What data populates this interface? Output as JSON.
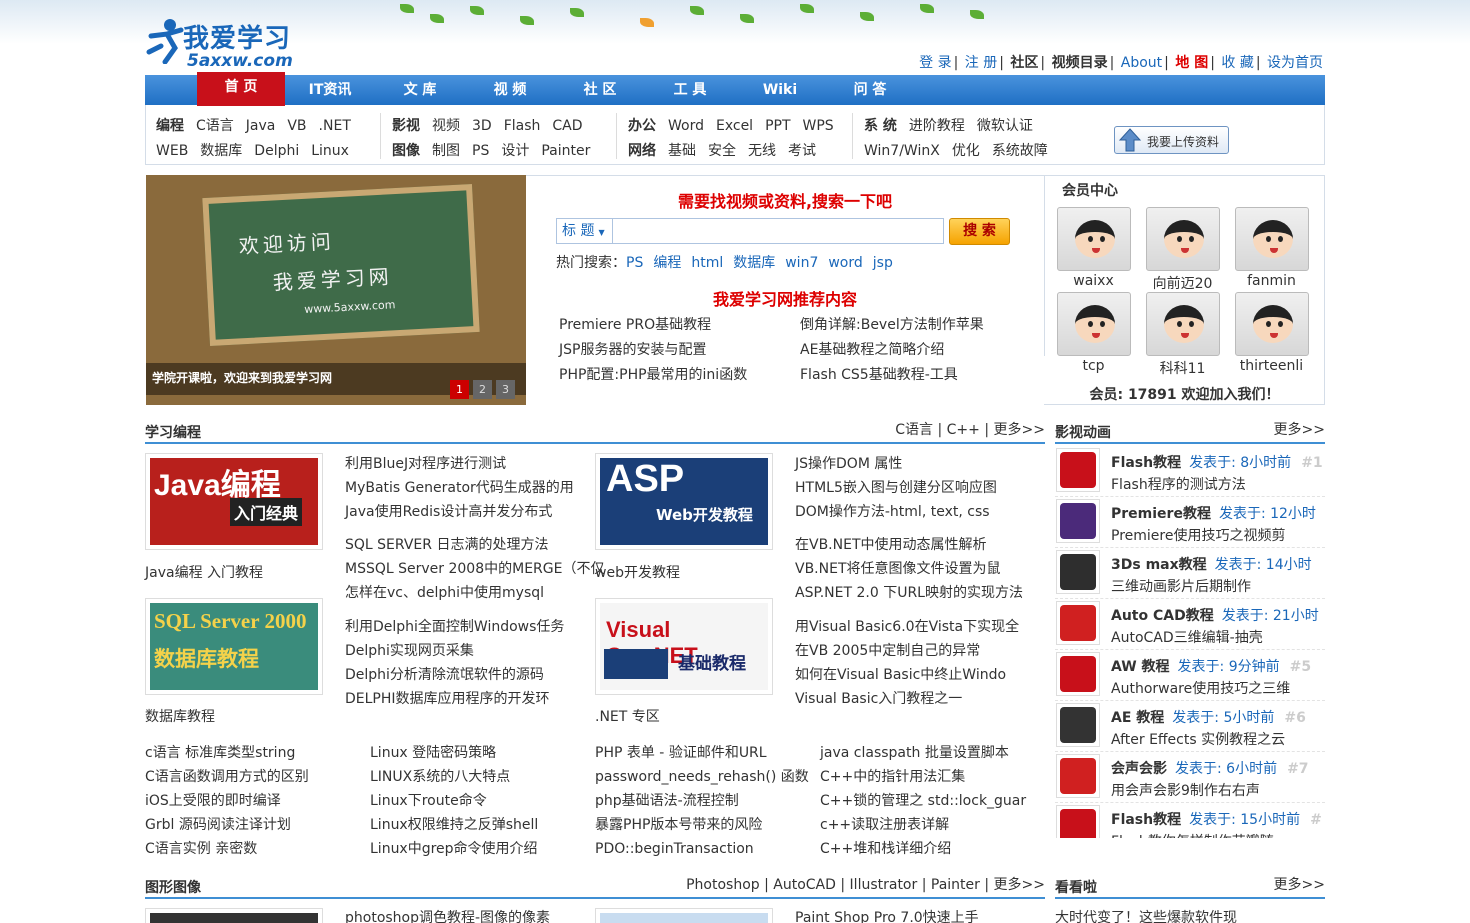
{
  "header": {
    "logo_cn": "我爱学习",
    "logo_en": "5axxw.com",
    "links": [
      "登 录",
      "注 册",
      "社区",
      "视频目录",
      "About",
      "地 图",
      "收 藏",
      "设为首页"
    ]
  },
  "nav": [
    "首 页",
    "IT资讯",
    "文 库",
    "视 频",
    "社 区",
    "工 具",
    "Wiki",
    "问 答"
  ],
  "subnav": {
    "g1": {
      "r1": {
        "head": "编程",
        "items": [
          "C语言",
          "Java",
          "VB",
          ".NET"
        ]
      },
      "r2": {
        "items": [
          "WEB",
          "数据库",
          "Delphi",
          "Linux"
        ]
      }
    },
    "g2": {
      "r1": {
        "head": "影视",
        "items": [
          "视频",
          "3D",
          "Flash",
          "CAD"
        ]
      },
      "r2": {
        "head": "图像",
        "items": [
          "制图",
          "PS",
          "设计",
          "Painter"
        ]
      }
    },
    "g3": {
      "r1": {
        "head": "办公",
        "items": [
          "Word",
          "Excel",
          "PPT",
          "WPS"
        ]
      },
      "r2": {
        "head": "网络",
        "items": [
          "基础",
          "安全",
          "无线",
          "考试"
        ]
      }
    },
    "g4": {
      "r1": {
        "head": "系 统",
        "items": [
          "进阶教程",
          "微软认证"
        ]
      },
      "r2": {
        "items": [
          "Win7/WinX",
          "优化",
          "系统故障"
        ]
      }
    },
    "upload": "我要上传资料"
  },
  "slide": {
    "board_line1": "欢迎访问",
    "board_line2": "我爱学习网",
    "board_line3": "www.5axxw.com",
    "caption": "学院开课啦，欢迎来到我爱学习网",
    "dots": [
      "1",
      "2",
      "3"
    ]
  },
  "search": {
    "title": "需要找视频或资料,搜索一下吧",
    "tag": "标 题",
    "button": "搜 索",
    "hot_label": "热门搜索：",
    "hot": [
      "PS",
      "编程",
      "html",
      "数据库",
      "win7",
      "word",
      "jsp"
    ]
  },
  "recommend": {
    "title": "我爱学习网推荐内容",
    "left": [
      "Premiere PRO基础教程",
      "JSP服务器的安装与配置",
      "PHP配置:PHP最常用的ini函数"
    ],
    "right": [
      "倒角详解:Bevel方法制作苹果",
      "AE基础教程之简略介绍",
      "Flash CS5基础教程-工具"
    ]
  },
  "member": {
    "title": "会员中心",
    "users": [
      "waixx",
      "向前迈20",
      "fanmin",
      "tcp",
      "科科11",
      "thirteenli"
    ],
    "total": "会员: 17891 欢迎加入我们！"
  },
  "programming": {
    "title": "学习编程",
    "more_links": [
      "C语言",
      "C++",
      "更多>>"
    ],
    "thumbs": [
      "Java编程 入门教程",
      "数据库教程",
      "ASP",
      "Web开发教程",
      ".NET 专区"
    ],
    "java_img": {
      "l1": "Java编程",
      "l2": "入门经典"
    },
    "sql_img": {
      "l1": "SQL Server 2000",
      "l2": "数据库教程"
    },
    "asp_img": {
      "l1": "ASP",
      "l2": "Web开发教程"
    },
    "vc_img": {
      "l1": "Visual C++.NET",
      "l2": "基础教程"
    },
    "list1": [
      "利用BlueJ对程序进行测试",
      "MyBatis Generator代码生成器的用",
      "Java使用Redis设计高并发分布式"
    ],
    "list2": [
      "SQL SERVER 日志满的处理方法",
      "MSSQL Server 2008中的MERGE（不仅",
      "怎样在vc、delphi中使用mysql"
    ],
    "list3": [
      "利用Delphi全面控制Windows任务",
      "Delphi实现网页采集",
      "Delphi分析清除流氓软件的源码",
      "DELPHI数据库应用程序的开发环"
    ],
    "list4": [
      "JS操作DOM 属性",
      "HTML5嵌入图与创建分区响应图",
      "DOM操作方法-html, text, css"
    ],
    "list5": [
      "在VB.NET中使用动态属性解析",
      "VB.NET将任意图像文件设置为鼠",
      "ASP.NET 2.0 下URL映射的实现方法"
    ],
    "list6": [
      "用Visual Basic6.0在Vista下实现全",
      "在VB 2005中定制自己的异常",
      "如何在Visual Basic中终止Windo",
      "Visual Basic入门教程之一"
    ],
    "web_caption": "web开发教程",
    "bottom1": [
      "c语言 标准库类型string",
      "C语言函数调用方式的区别",
      "iOS上受限的即时编译",
      "Grbl 源码阅读注译计划",
      "C语言实例 亲密数"
    ],
    "bottom2": [
      "Linux 登陆密码策略",
      "LINUX系统的八大特点",
      "Linux下route命令",
      "Linux权限维持之反弹shell",
      "Linux中grep命令使用介绍"
    ],
    "bottom3": [
      "PHP 表单 - 验证邮件和URL",
      "password_needs_rehash() 函数",
      "php基础语法-流程控制",
      "暴露PHP版本号带来的风险",
      "PDO::beginTransaction"
    ],
    "bottom4": [
      "java classpath 批量设置脚本",
      "C++中的指针用法汇集",
      "C++锁的管理之 std::lock_guar",
      "c++读取注册表详解",
      "C++堆和栈详细介绍"
    ]
  },
  "video": {
    "title": "影视动画",
    "more": "更多>>",
    "items": [
      {
        "head": "Flash教程",
        "time": "发表于: 8小时前",
        "num": "#1",
        "desc": "Flash程序的测试方法",
        "icon": "flash-icon",
        "color": "#c8101a"
      },
      {
        "head": "Premiere教程",
        "time": "发表于: 12小时",
        "num": "",
        "desc": "Premiere使用技巧之视频剪",
        "icon": "premiere-icon",
        "color": "#4b2a7a"
      },
      {
        "head": "3Ds max教程",
        "time": "发表于: 14小时",
        "num": "",
        "desc": "三维动画影片后期制作",
        "icon": "3dsmax-icon",
        "color": "#2e2e2e"
      },
      {
        "head": "Auto CAD教程",
        "time": "发表于: 21小时",
        "num": "",
        "desc": "AutoCAD三维编辑-抽壳",
        "icon": "autocad-icon",
        "color": "#d02020"
      },
      {
        "head": "AW 教程",
        "time": "发表于: 9分钟前",
        "num": "#5",
        "desc": "Authorware使用技巧之三维",
        "icon": "authorware-icon",
        "color": "#c8101a"
      },
      {
        "head": "AE 教程",
        "time": "发表于: 5小时前",
        "num": "#6",
        "desc": "After Effects 实例教程之云",
        "icon": "after-effects-icon",
        "color": "#333"
      },
      {
        "head": "会声会影",
        "time": "发表于: 6小时前",
        "num": "#7",
        "desc": "用会声会影9制作右右声",
        "icon": "speaker-icon",
        "color": "#d02020"
      },
      {
        "head": "Flash教程",
        "time": "发表于: 15小时前",
        "num": "#",
        "desc": "Flash教你怎样制作花瓣随",
        "icon": "flash-icon",
        "color": "#c8101a"
      }
    ]
  },
  "graphics": {
    "title": "图形图像",
    "more_links": [
      "Photoshop",
      "AutoCAD",
      "Illustrator",
      "Painter",
      "更多>>"
    ],
    "list_left": "photoshop调色教程-图像的像素",
    "list_right": "Paint Shop Pro 7.0快速上手"
  },
  "watch": {
    "title": "看看啦",
    "more": "更多>>",
    "item": "大时代变了！这些爆款软件现"
  }
}
